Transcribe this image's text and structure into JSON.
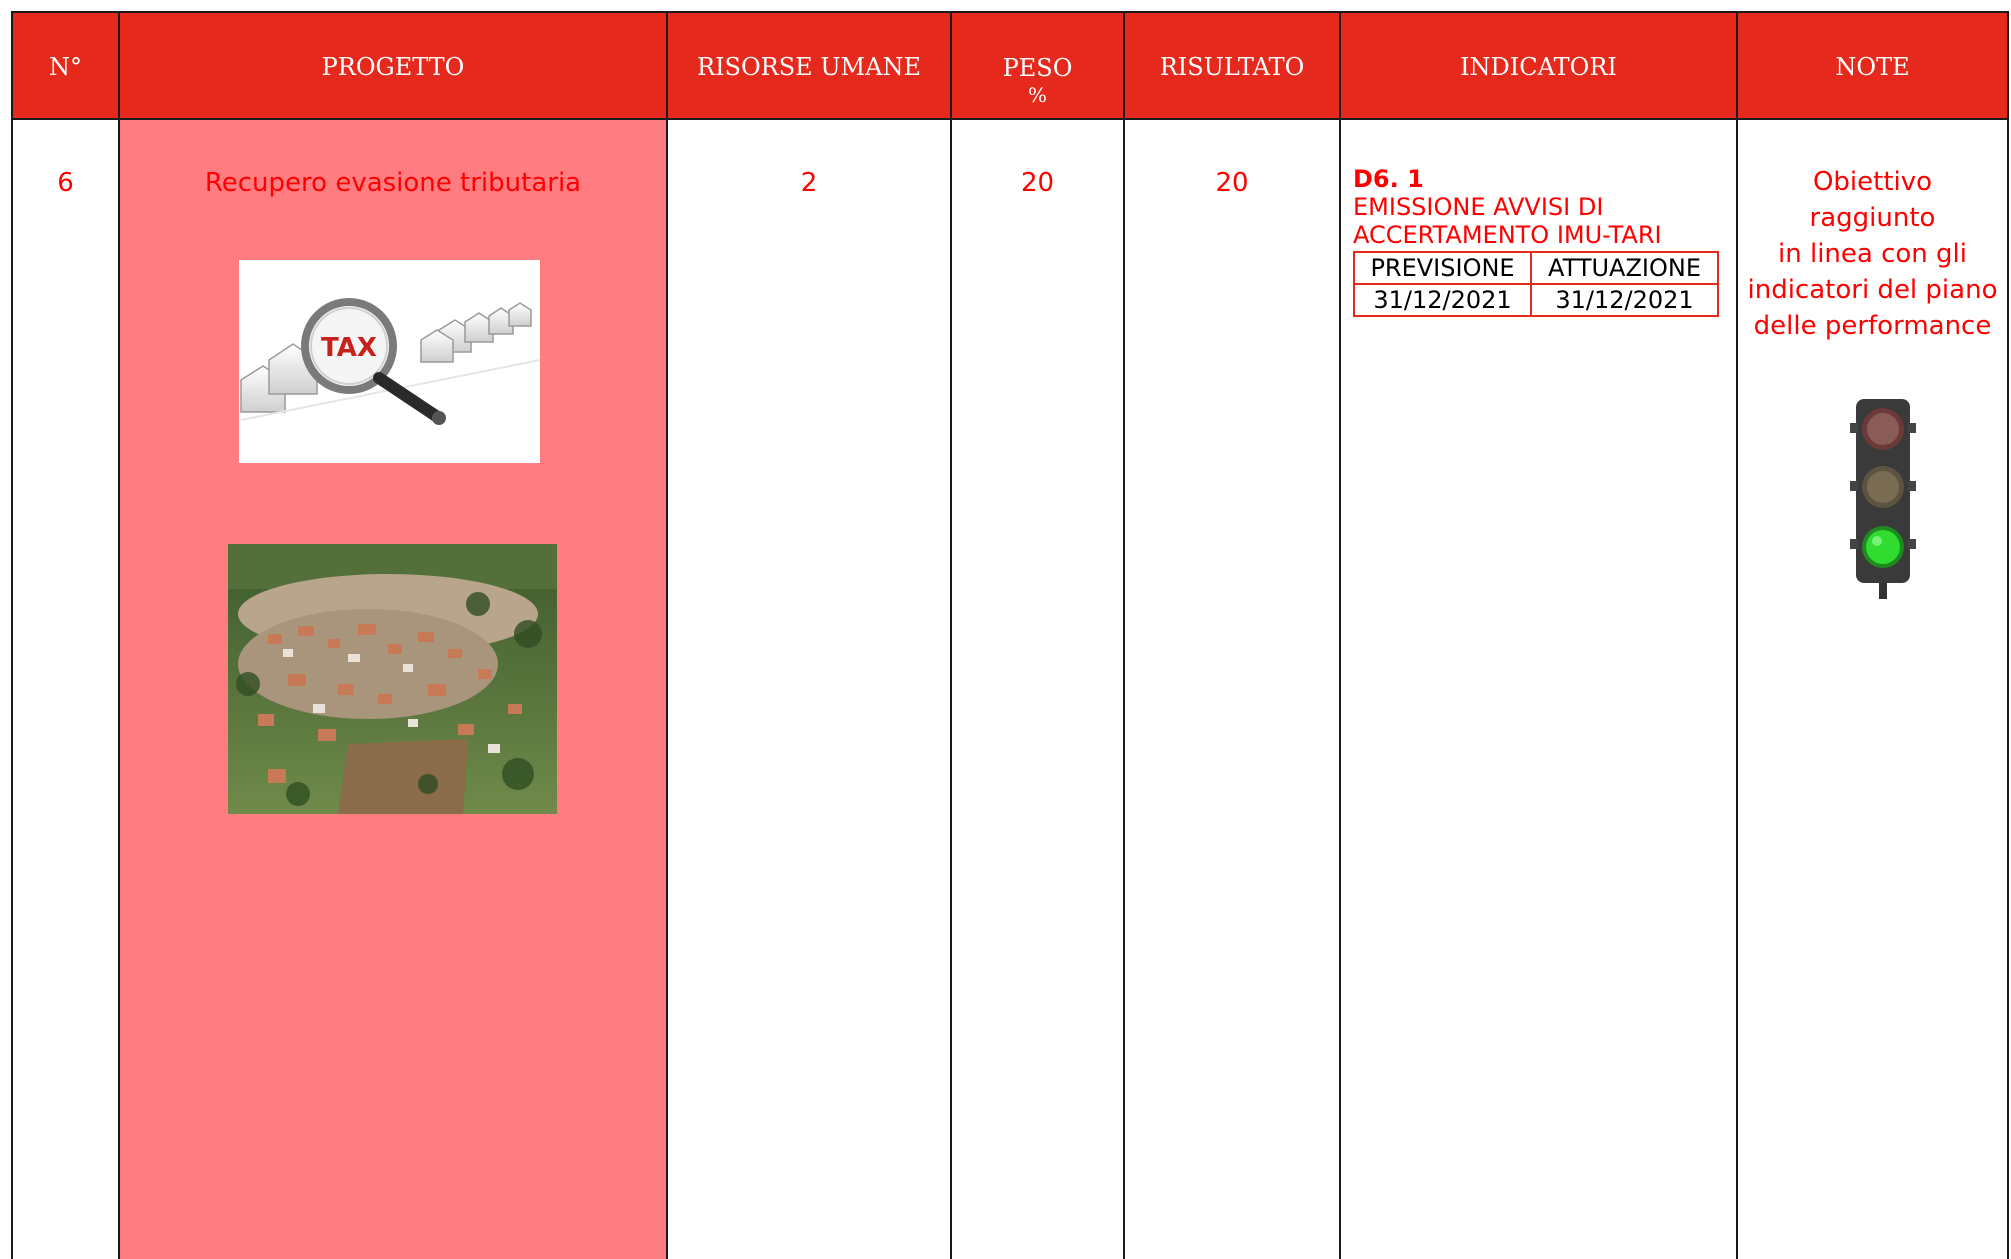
{
  "header": {
    "num": "N°",
    "progetto": "PROGETTO",
    "risorse": "RISORSE UMANE",
    "peso_line1": "PESO",
    "peso_line2": "%",
    "risultato": "RISULTATO",
    "indicatori": "INDICATORI",
    "note": "NOTE"
  },
  "row": {
    "num": "6",
    "progetto": "Recupero evasione tributaria",
    "risorse": "2",
    "peso": "20",
    "risultato": "20",
    "indicator": {
      "code": "D6. 1",
      "line1": "EMISSIONE AVVISI DI",
      "line2": "ACCERTAMENTO IMU-TARI",
      "table_headers": [
        "PREVISIONE",
        "ATTUAZIONE"
      ],
      "table_values": [
        "31/12/2021",
        "31/12/2021"
      ]
    },
    "note_lines": [
      "Obiettivo",
      "raggiunto",
      "in linea con gli",
      "indicatori del piano",
      "delle performance"
    ],
    "image_labels": {
      "tax": "TAX"
    }
  },
  "colors": {
    "header_bg": "#e52a1d",
    "project_bg": "#ff7c80",
    "text_red": "#ff0000",
    "traffic_light": "green"
  }
}
